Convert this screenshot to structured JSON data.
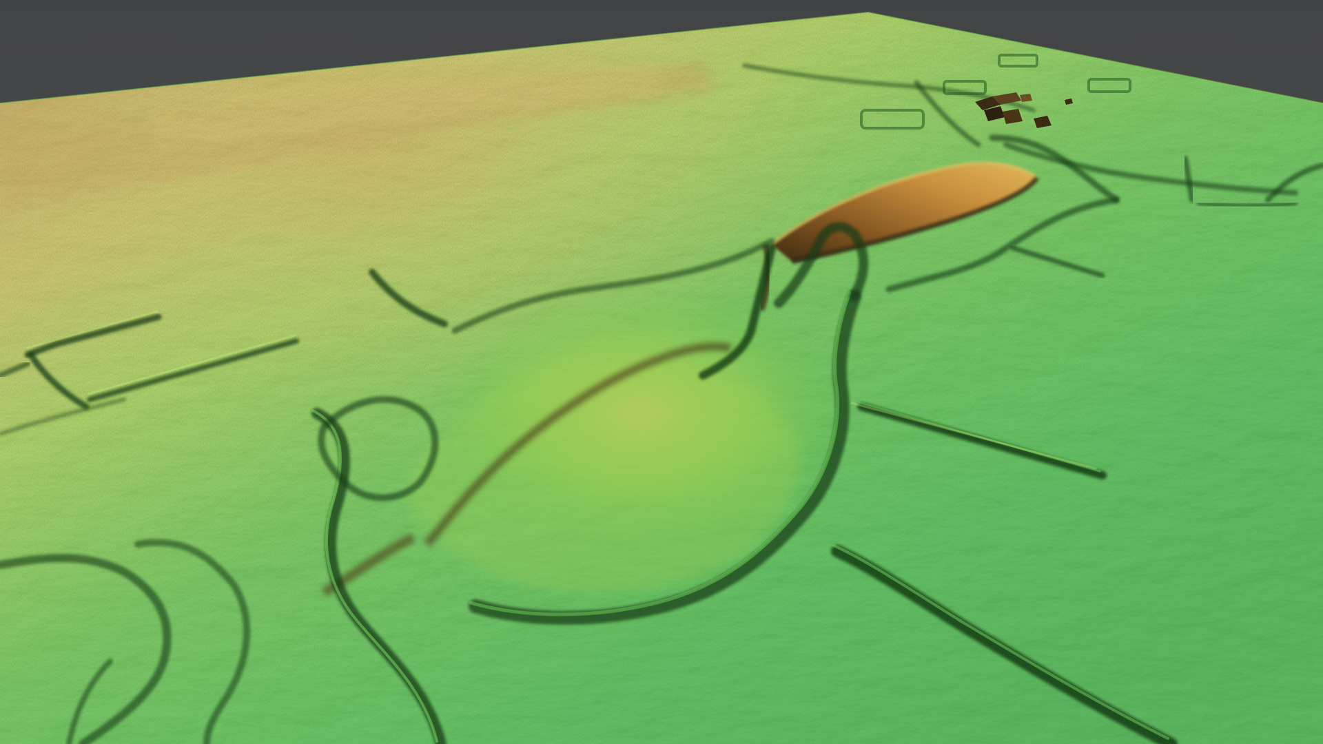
{
  "scene": {
    "kind": "3d-terrain-elevation-model",
    "colors": {
      "background_top": "#424345",
      "background_bottom": "#5a5b5d",
      "low_ground": "#34b544",
      "mid_ground": "#8ccf4a",
      "high_ground": "#d8c25a",
      "peak_ground": "#d29a4a",
      "channel_shadow": "#123a12",
      "ridge_brown": "#7a4d1e"
    },
    "icons": {
      "terrain": "terrain-surface",
      "buildings": "farm-buildings-cluster"
    }
  }
}
